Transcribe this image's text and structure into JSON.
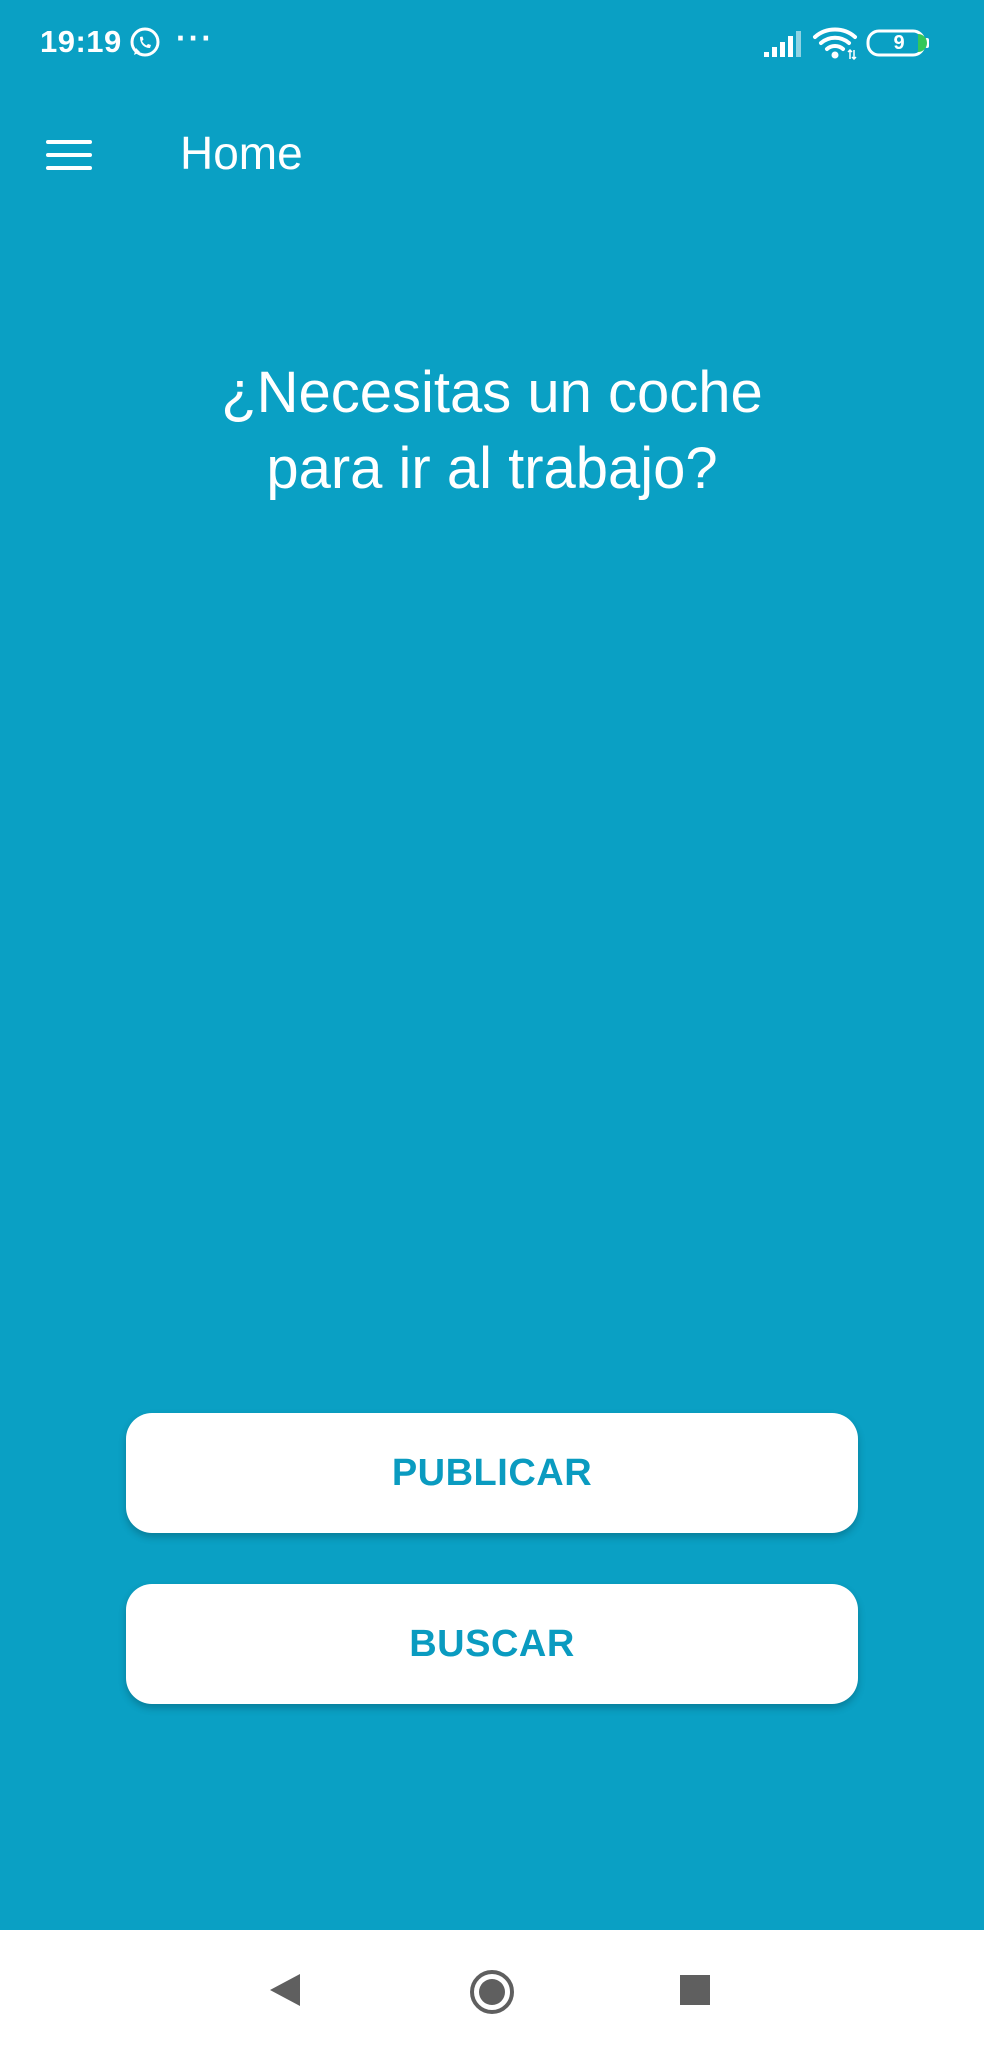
{
  "status_bar": {
    "time": "19:19",
    "more": "···",
    "battery_level": "9"
  },
  "app_bar": {
    "title": "Home"
  },
  "main": {
    "headline_line1": "¿Necesitas un coche",
    "headline_line2": "para ir al trabajo?",
    "publish_label": "PUBLICAR",
    "search_label": "BUSCAR"
  },
  "colors": {
    "background": "#0aa0c4",
    "accent_text": "#0a9bc0",
    "button_bg": "#ffffff",
    "nav_bar_bg": "#ffffff"
  },
  "icons": {
    "status": [
      "whatsapp-icon",
      "signal-icon",
      "wifi-icon",
      "battery-icon"
    ],
    "app_bar": [
      "hamburger-menu-icon"
    ],
    "nav": [
      "back-icon",
      "home-icon",
      "recents-icon"
    ]
  }
}
